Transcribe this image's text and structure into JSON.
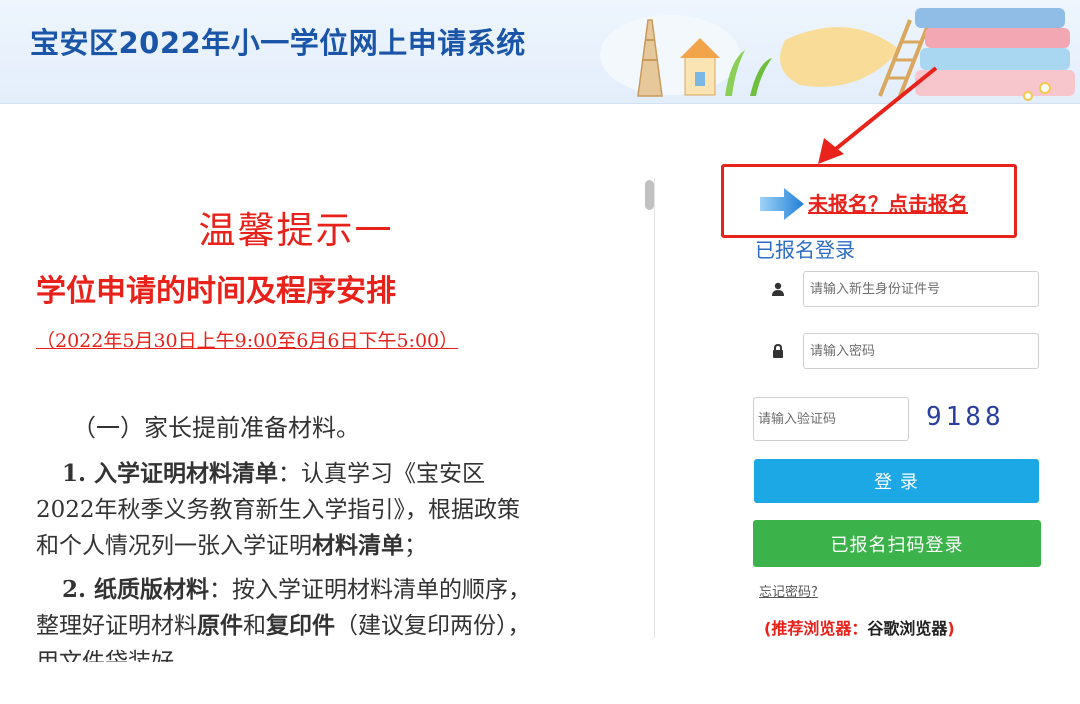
{
  "header": {
    "title": "宝安区2022年小一学位网上申请系统"
  },
  "notice": {
    "title": "温馨提示一",
    "subtitle": "学位申请的时间及程序安排",
    "date_range": "（2022年5月30日上午9:00至6月6日下午5:00）",
    "section_heading": "（一）家长提前准备材料。",
    "item1_lead": "1. 入学证明材料清单",
    "item1_text": "：认真学习《宝安区2022年秋季义务教育新生入学指引》，根据政策和个人情况列一张入学证明",
    "item1_bold_tail": "材料清单",
    "item1_end": "；",
    "item2_lead": "2. 纸质版材料",
    "item2_text_a": "：按入学证明材料清单的顺序，整理好证明材料",
    "item2_bold_a": "原件",
    "item2_text_b": "和",
    "item2_bold_b": "复印件",
    "item2_text_c": "（建议复印两份），用文件袋装好。"
  },
  "register": {
    "link_label": "未报名？点击报名"
  },
  "login": {
    "heading": "已报名登录",
    "id_placeholder": "请输入新生身份证件号",
    "password_placeholder": "请输入密码",
    "captcha_placeholder": "请输入验证码",
    "captcha_code": "9188",
    "login_button": "登 录",
    "scan_button": "已报名扫码登录",
    "forgot_link": "忘记密码?",
    "browser_tip_prefix": "(推荐浏览器：",
    "browser_tip_name": "谷歌浏览器",
    "browser_tip_suffix": ")"
  },
  "colors": {
    "brand_blue": "#1a55a8",
    "alert_red": "#e8211a",
    "login_blue": "#1ba8e4",
    "scan_green": "#3bb34a"
  },
  "icons": {
    "user": "user-icon",
    "lock": "lock-icon",
    "arrow": "arrow-right-icon"
  }
}
